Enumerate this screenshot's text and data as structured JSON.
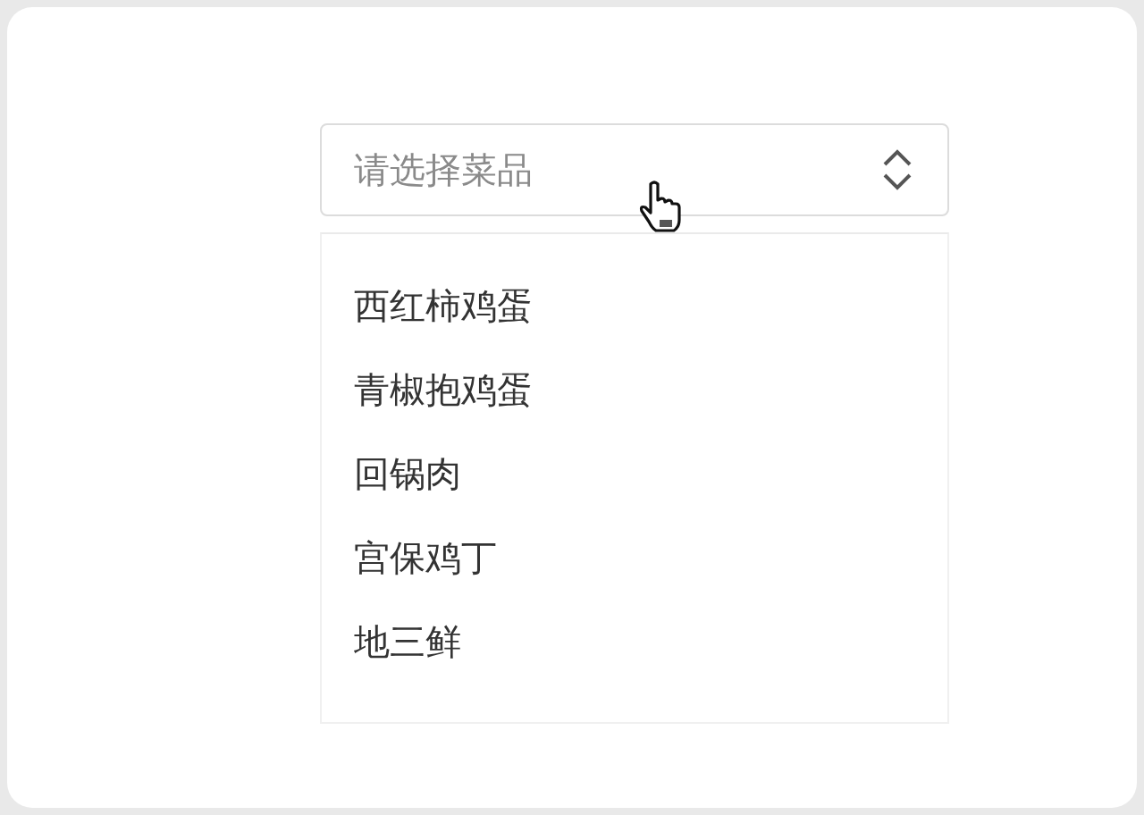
{
  "select": {
    "placeholder": "请选择菜品",
    "expanded": true
  },
  "options": [
    {
      "label": "西红柿鸡蛋"
    },
    {
      "label": "青椒抱鸡蛋"
    },
    {
      "label": "回锅肉"
    },
    {
      "label": "宫保鸡丁"
    },
    {
      "label": "地三鲜"
    }
  ]
}
